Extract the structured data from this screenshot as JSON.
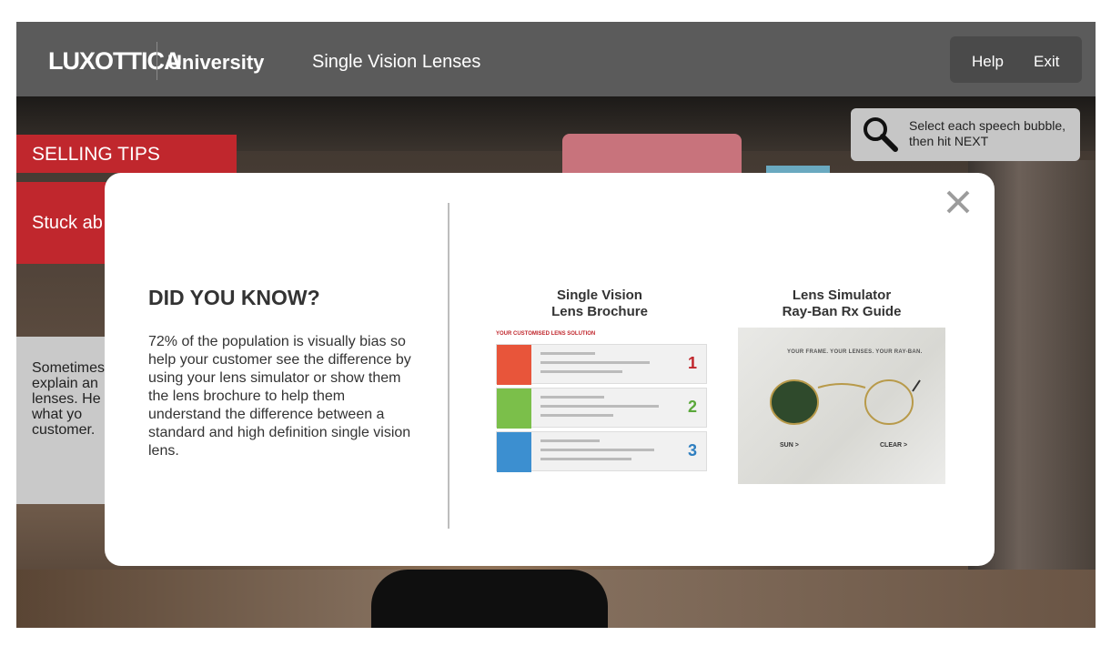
{
  "header": {
    "logo": "LUXOTTICA",
    "brand_suffix": "University",
    "course_title": "Single Vision Lenses",
    "help_label": "Help",
    "exit_label": "Exit"
  },
  "hint": {
    "text": "Select each speech bubble, then hit NEXT",
    "icon": "magnifier-icon"
  },
  "background": {
    "selling_tips_label": "SELLING TIPS",
    "bubble_text": "Stuck ab",
    "gray_panel_text": "Sometimes explain an lenses. He on what yo customer."
  },
  "modal": {
    "title": "DID YOU KNOW?",
    "body": "72% of the population is visually bias so help your customer see the difference by using your lens simulator or show them the lens brochure to help them understand the difference between a standard and high definition single vision lens.",
    "close_icon": "close-icon",
    "resources": [
      {
        "title_line1": "Single Vision",
        "title_line2": "Lens Brochure",
        "thumb_heading": "YOUR CUSTOMISED LENS SOLUTION",
        "step_numbers": [
          "1",
          "2",
          "3"
        ]
      },
      {
        "title_line1": "Lens Simulator",
        "title_line2": "Ray-Ban Rx Guide",
        "thumb_caption": "YOUR FRAME. YOUR LENSES. YOUR RAY-BAN.",
        "thumb_left_label": "SUN >",
        "thumb_right_label": "CLEAR >"
      }
    ]
  },
  "colors": {
    "brand_red": "#c0272d",
    "topbar": "#5b5b5b",
    "nav_box": "#4a4a4a",
    "hint_bg": "#c6c6c6"
  }
}
